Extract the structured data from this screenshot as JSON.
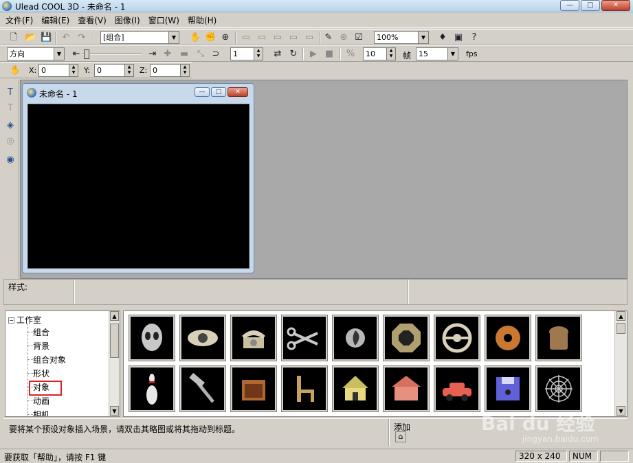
{
  "window": {
    "title": "Ulead COOL 3D - 未命名 - 1"
  },
  "menu": [
    "文件(F)",
    "编辑(E)",
    "查看(V)",
    "图像(I)",
    "窗口(W)",
    "帮助(H)"
  ],
  "toolbar1": {
    "object_combo": "[组合]",
    "zoom_combo": "100%"
  },
  "toolbar2": {
    "mode_combo": "方向",
    "frame_spin": "1",
    "frames_label": "帧",
    "frames_spin": "10",
    "fps_combo": "15",
    "fps_label": "fps"
  },
  "toolbar3": {
    "x_label": "X:",
    "x_value": "0",
    "y_label": "Y:",
    "y_value": "0",
    "z_label": "Z:",
    "z_value": "0"
  },
  "document": {
    "title": "未命名 - 1"
  },
  "stylebar": {
    "label": "样式:"
  },
  "tree": {
    "root": "工作室",
    "items": [
      "组合",
      "背景",
      "组合对象",
      "形状",
      "对象",
      "动画",
      "相机"
    ]
  },
  "thumbnails": {
    "row1": [
      "alien-head",
      "eye",
      "telephone",
      "scissors",
      "swirl",
      "octagon-ring",
      "steering-wheel",
      "donut",
      "bread"
    ],
    "row2": [
      "bowling-pin",
      "hammer",
      "cabinet",
      "chair",
      "doghouse",
      "barn",
      "car",
      "floppy-disk",
      "spider-web"
    ]
  },
  "hint": {
    "text": "要将某个预设对象插入场景，请双击其略图或将其拖动到标题。",
    "add_label": "添加"
  },
  "status": {
    "help": "要获取「帮助」，请按 F1 键",
    "size": "320 x 240",
    "num": "NUM"
  },
  "watermark": {
    "brand": "Bai du 经验",
    "url": "jingyan.baidu.com"
  }
}
